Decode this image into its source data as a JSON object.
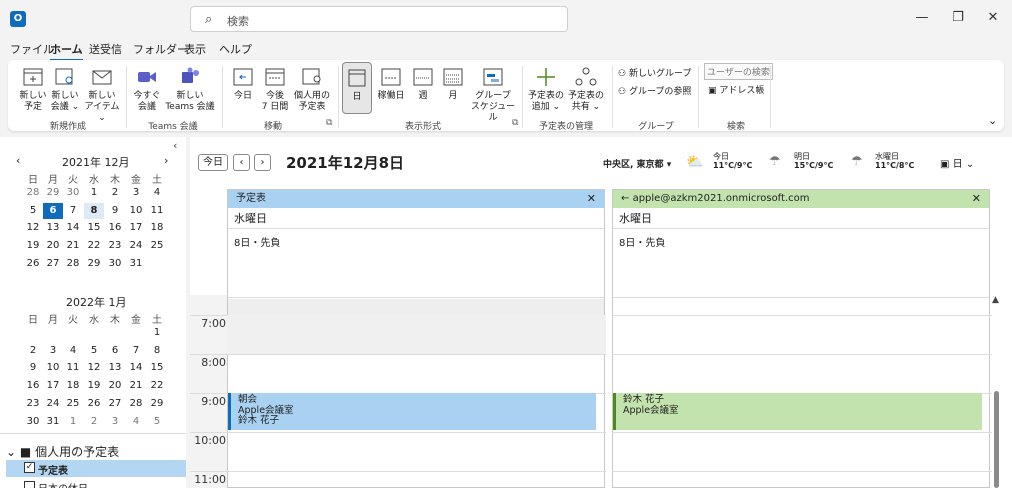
{
  "titlebar": {
    "search_placeholder": "検索",
    "app_letter": "O"
  },
  "menu": [
    "ファイル",
    "ホーム",
    "送受信",
    "フォルダー",
    "表示",
    "ヘルプ"
  ],
  "ribbon": {
    "new": {
      "appt": [
        "新しい",
        "予定"
      ],
      "meeting": [
        "新しい",
        "会議 ⌄"
      ],
      "item": [
        "新しい",
        "アイテム ⌄"
      ],
      "group": "新規作成"
    },
    "teams": {
      "now": [
        "今すぐ",
        "会議"
      ],
      "new": [
        "新しい",
        "Teams 会議"
      ],
      "group": "Teams 会議"
    },
    "goto": {
      "today": "今日",
      "next7": [
        "今後",
        "7 日間"
      ],
      "personal": [
        "個人用の",
        "予定表"
      ],
      "group": "移動"
    },
    "view": {
      "day": "日",
      "workweek": "稼働日",
      "week": "週",
      "month": "月",
      "schedule": [
        "グループ",
        "スケジュール"
      ],
      "group": "表示形式"
    },
    "manage": {
      "add": [
        "予定表の",
        "追加 ⌄"
      ],
      "share": [
        "予定表の",
        "共有 ⌄"
      ],
      "group": "予定表の管理"
    },
    "groups": {
      "new": "新しいグループ",
      "browse": "グループの参照",
      "group": "グループ"
    },
    "find": {
      "user_search": "ユーザーの検索",
      "addressbook": "アドレス帳",
      "group": "検索"
    }
  },
  "mini_cal": {
    "dec": {
      "title": "2021年 12月",
      "weekdays": [
        "日",
        "月",
        "火",
        "水",
        "木",
        "金",
        "土"
      ],
      "rows": [
        [
          "28",
          "29",
          "30",
          "1",
          "2",
          "3",
          "4"
        ],
        [
          "5",
          "6",
          "7",
          "8",
          "9",
          "10",
          "11"
        ],
        [
          "12",
          "13",
          "14",
          "15",
          "16",
          "17",
          "18"
        ],
        [
          "19",
          "20",
          "21",
          "22",
          "23",
          "24",
          "25"
        ],
        [
          "26",
          "27",
          "28",
          "29",
          "30",
          "31",
          ""
        ]
      ]
    },
    "jan": {
      "title": "2022年 1月",
      "weekdays": [
        "日",
        "月",
        "火",
        "水",
        "木",
        "金",
        "土"
      ],
      "rows": [
        [
          "",
          "",
          "",
          "",
          "",
          "",
          "1"
        ],
        [
          "2",
          "3",
          "4",
          "5",
          "6",
          "7",
          "8"
        ],
        [
          "9",
          "10",
          "11",
          "12",
          "13",
          "14",
          "15"
        ],
        [
          "16",
          "17",
          "18",
          "19",
          "20",
          "21",
          "22"
        ],
        [
          "23",
          "24",
          "25",
          "26",
          "27",
          "28",
          "29"
        ],
        [
          "30",
          "31",
          "1",
          "2",
          "3",
          "4",
          "5"
        ]
      ]
    }
  },
  "folders": {
    "section": "個人用の予定表",
    "calendar": "予定表",
    "holidays": "日本の休日"
  },
  "main": {
    "today_btn": "今日",
    "date_title": "2021年12月8日",
    "location": "中央区, 東京都",
    "weather": [
      {
        "day": "今日",
        "temp": "11°C/9°C"
      },
      {
        "day": "明日",
        "temp": "15°C/9°C"
      },
      {
        "day": "水曜日",
        "temp": "11°C/8°C"
      }
    ],
    "view_mode": "日"
  },
  "columns": [
    {
      "title": "予定表",
      "weekday": "水曜日",
      "rokuyo": "8日・先負",
      "color": "#a9d2f2",
      "event_color": "#a9d2f2",
      "event_bar": "#0f6cbd",
      "event": [
        "朝会",
        "Apple会議室",
        "鈴木 花子"
      ]
    },
    {
      "title": "apple@azkm2021.onmicrosoft.com",
      "weekday": "水曜日",
      "rokuyo": "8日・先負",
      "color": "#c3e3ae",
      "event_color": "#c3e3ae",
      "event_bar": "#4a8a1f",
      "event": [
        "鈴木 花子",
        "Apple会議室"
      ]
    }
  ],
  "times": [
    "7:00",
    "8:00",
    "9:00",
    "10:00",
    "11:00"
  ]
}
